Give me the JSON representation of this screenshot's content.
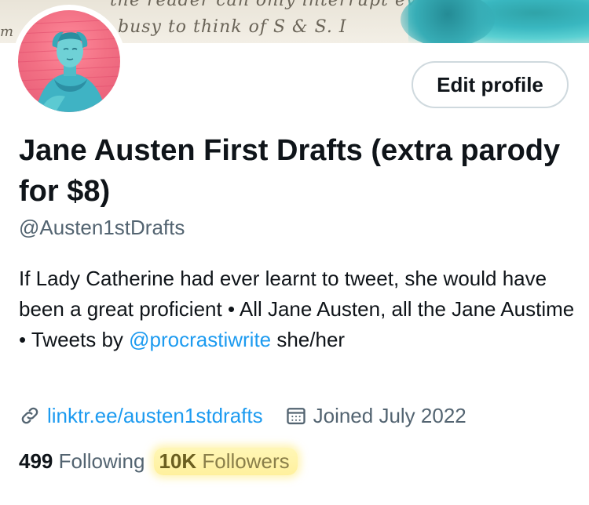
{
  "banner": {
    "handwriting_top": "the reader can only interrupt every my Brother Only will",
    "handwriting_bottom": "busy to think of S & S. I"
  },
  "profile": {
    "name": "Jane Austen First Drafts (extra parody for $8)",
    "handle": "@Austen1stDrafts",
    "edit_button": "Edit profile",
    "bio_part1": "If Lady Catherine had ever learnt to tweet, she would have been a great proficient • All Jane Austen, all the Jane Austime • Tweets by ",
    "bio_mention": "@procrastiwrite",
    "bio_part2": " she/her",
    "link": "linktr.ee/austen1stdrafts",
    "joined": "Joined July 2022"
  },
  "stats": {
    "following_count": "499",
    "following_label": "Following",
    "followers_count": "10K",
    "followers_label": "Followers"
  },
  "colors": {
    "accent": "#1d9bf0",
    "text": "#0f1419",
    "secondary": "#536471",
    "highlight": "#fff1a0"
  },
  "icons": {
    "link": "link-icon",
    "calendar": "calendar-icon"
  }
}
